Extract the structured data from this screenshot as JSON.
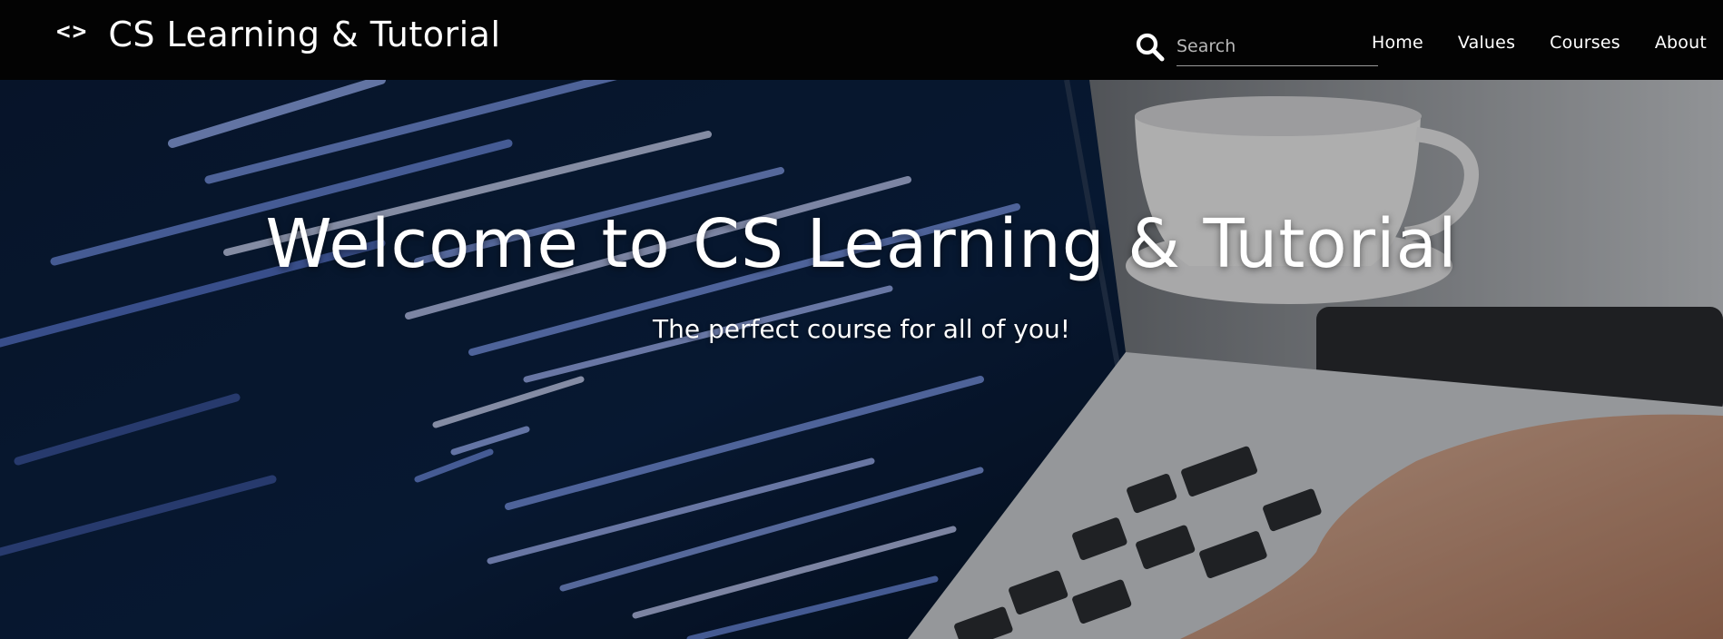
{
  "brand": {
    "icon": "code-brackets-icon",
    "icon_glyph": "<>",
    "title": "CS Learning & Tutorial"
  },
  "search": {
    "icon": "search-icon",
    "placeholder": "Search",
    "value": ""
  },
  "nav": {
    "items": [
      {
        "label": "Home"
      },
      {
        "label": "Values"
      },
      {
        "label": "Courses"
      },
      {
        "label": "About"
      }
    ]
  },
  "hero": {
    "title": "Welcome to CS Learning & Tutorial",
    "subtitle": "The perfect course for all of you!",
    "background": "laptop-with-code-and-coffee-cup-photo"
  },
  "colors": {
    "navbar_bg": "#030303",
    "text": "#ffffff"
  }
}
